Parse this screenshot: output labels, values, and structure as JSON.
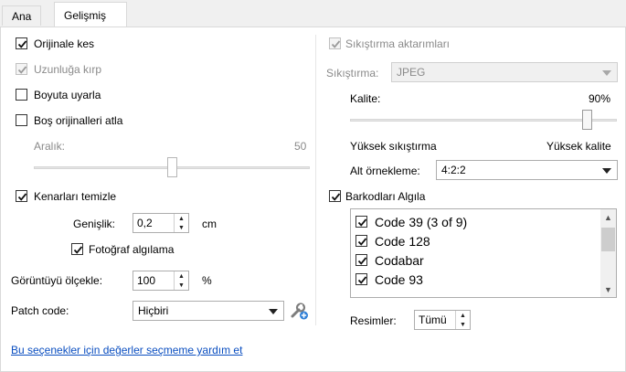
{
  "tabs": [
    {
      "label": "Ana",
      "active": false
    },
    {
      "label": "Gelişmiş",
      "active": true
    }
  ],
  "left": {
    "crop_original": {
      "label": "Orijinale kes",
      "checked": true,
      "enabled": true
    },
    "crop_to_length": {
      "label": "Uzunluğa kırp",
      "checked": true,
      "enabled": false
    },
    "fit_to_size": {
      "label": "Boyuta uyarla",
      "checked": false,
      "enabled": true
    },
    "skip_blank": {
      "label": "Boş orijinalleri atla",
      "checked": false,
      "enabled": true
    },
    "range": {
      "label": "Aralık:",
      "value": "50",
      "enabled": false,
      "level": 0.5
    },
    "clean_edges": {
      "label": "Kenarları temizle",
      "checked": true
    },
    "width": {
      "label": "Genişlik:",
      "value": "0,2",
      "unit": "cm"
    },
    "photo_detect": {
      "label": "Fotoğraf algılama",
      "checked": true
    },
    "scale": {
      "label": "Görüntüyü ölçekle:",
      "value": "100",
      "unit": "%"
    },
    "patch_code": {
      "label": "Patch code:",
      "value": "Hiçbiri"
    }
  },
  "right": {
    "compress_transfers": {
      "label": "Sıkıştırma aktarımları",
      "checked": true,
      "enabled": false
    },
    "compression": {
      "label": "Sıkıştırma:",
      "value": "JPEG",
      "enabled": false
    },
    "quality": {
      "label": "Kalite:",
      "value": "90%",
      "level": 0.9
    },
    "high_compression": "Yüksek sıkıştırma",
    "high_quality": "Yüksek kalite",
    "subsampling": {
      "label": "Alt örnekleme:",
      "value": "4:2:2"
    },
    "detect_barcodes": {
      "label": "Barkodları Algıla",
      "checked": true
    },
    "barcodes": [
      {
        "label": "Code 39 (3 of 9)",
        "checked": true
      },
      {
        "label": "Code 128",
        "checked": true
      },
      {
        "label": "Codabar",
        "checked": true
      },
      {
        "label": "Code 93",
        "checked": true
      }
    ],
    "images": {
      "label": "Resimler:",
      "value": "Tümü"
    }
  },
  "help_link": "Bu seçenekler için değerler seçmeme yardım et",
  "colors": {
    "link": "#0a4ec0",
    "disabled_text": "#8a8a8a"
  },
  "icons": {
    "patch_tool": "wrench-plus-icon",
    "check": "checkmark-icon"
  }
}
